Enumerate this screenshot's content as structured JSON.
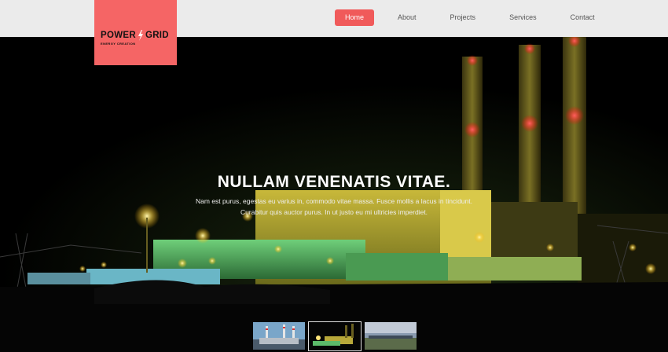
{
  "brand": {
    "name_left": "POWER",
    "name_right": "GRID",
    "tagline": "ENERGY CREATION",
    "accent_color": "#f56565"
  },
  "nav": {
    "items": [
      {
        "label": "Home",
        "active": true
      },
      {
        "label": "About",
        "active": false
      },
      {
        "label": "Projects",
        "active": false
      },
      {
        "label": "Services",
        "active": false
      },
      {
        "label": "Contact",
        "active": false
      }
    ]
  },
  "hero": {
    "title": "NULLAM VENENATIS VITAE.",
    "line1": "Nam est purus, egestas eu varius in, commodo vitae massa. Fusce mollis a lacus in tincidunt.",
    "line2": "Curabitur quis auctor purus. In ut justo eu mi ultricies imperdiet."
  },
  "thumbnails": [
    {
      "label": "slide-1",
      "selected": false
    },
    {
      "label": "slide-2",
      "selected": true
    },
    {
      "label": "slide-3",
      "selected": false
    }
  ]
}
